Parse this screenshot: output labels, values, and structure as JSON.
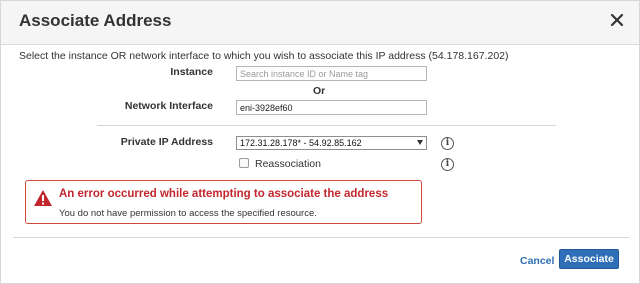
{
  "dialog": {
    "title": "Associate Address",
    "instructions": "Select the instance OR network interface to which you wish to associate this IP address (54.178.167.202)"
  },
  "form": {
    "instance_label": "Instance",
    "instance_placeholder": "Search instance ID or Name tag",
    "instance_value": "",
    "or_label": "Or",
    "network_interface_label": "Network Interface",
    "network_interface_value": "eni-3928ef60",
    "private_ip_label": "Private IP Address",
    "private_ip_selected": "172.31.28.178* - 54.92.85.162",
    "reassociation_label": "Reassociation",
    "reassociation_checked": false
  },
  "error": {
    "title": "An error occurred while attempting to associate the address",
    "message": "You do not have permission to access the specified resource."
  },
  "footer": {
    "cancel_label": "Cancel",
    "associate_label": "Associate"
  },
  "colors": {
    "primary": "#2f6fb8",
    "error": "#c1272d",
    "link": "#2f6fb3"
  },
  "icons": [
    "close-icon",
    "info-icon",
    "warning-icon",
    "chevron-down-icon"
  ]
}
